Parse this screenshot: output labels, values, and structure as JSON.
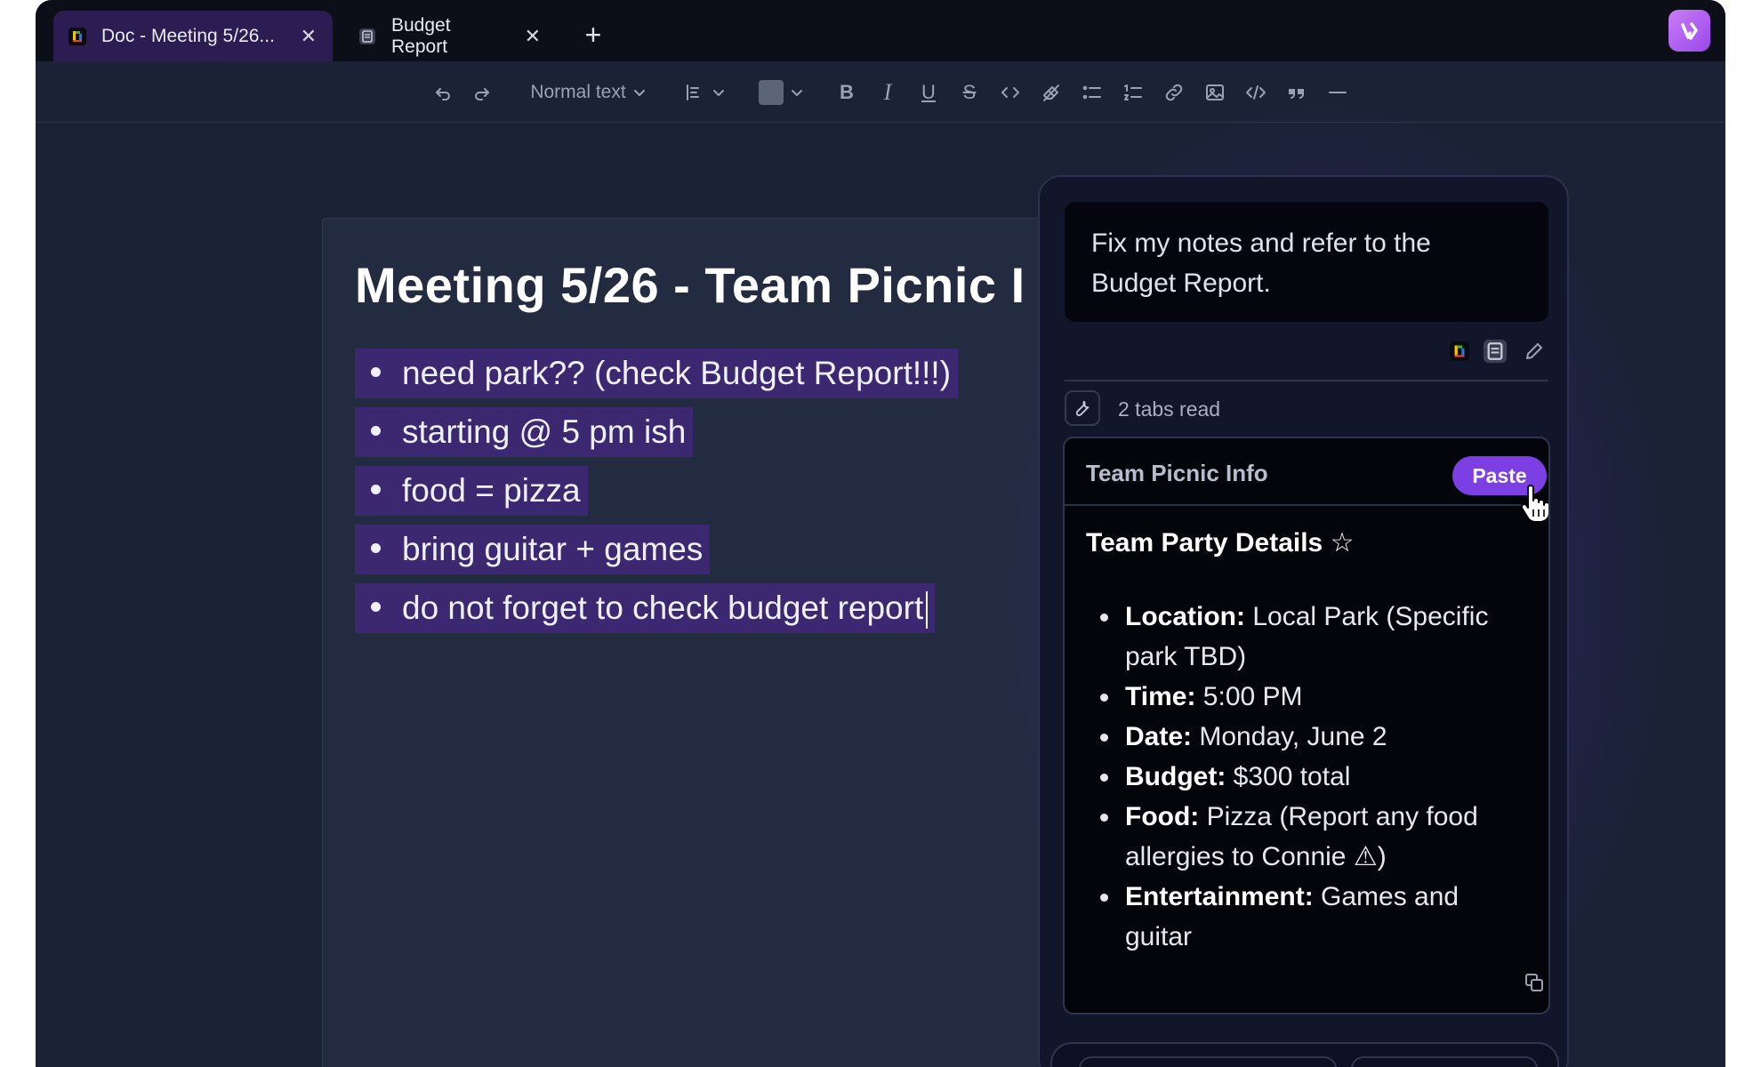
{
  "tabs": [
    {
      "title": "Doc - Meeting 5/26...",
      "icon": "doc-app-icon",
      "active": true
    },
    {
      "title": "Budget Report",
      "icon": "page-icon",
      "active": false
    }
  ],
  "tab_close_glyph": "✕",
  "new_tab_glyph": "+",
  "toolbar": {
    "text_style": "Normal text",
    "bold": "B",
    "italic": "I",
    "underline": "U",
    "strike": "S"
  },
  "document": {
    "title": "Meeting 5/26 - Team Picnic I",
    "notes": [
      "need park?? (check Budget Report!!!)",
      "starting @ 5 pm ish",
      "food = pizza",
      "bring guitar + games",
      "do not forget to check budget report"
    ]
  },
  "assistant": {
    "prompt": "Fix my notes and refer to the Budget Report.",
    "tabs_read": "2 tabs read",
    "card": {
      "header": "Team Picnic Info",
      "paste_label": "Paste",
      "title": "Team Party Details ☆",
      "items": [
        {
          "label": "Location:",
          "value": " Local Park (Specific park TBD)"
        },
        {
          "label": "Time:",
          "value": " 5:00 PM"
        },
        {
          "label": "Date:",
          "value": " Monday, June 2"
        },
        {
          "label": "Budget:",
          "value": " $300 total"
        },
        {
          "label": "Food:",
          "value": " Pizza (Report any food allergies to Connie ⚠)"
        },
        {
          "label": "Entertainment:",
          "value": " Games and guitar"
        }
      ]
    }
  },
  "colors": {
    "accent": "#7b3fe4",
    "highlight": "#3b2870",
    "background": "#1b2236"
  }
}
